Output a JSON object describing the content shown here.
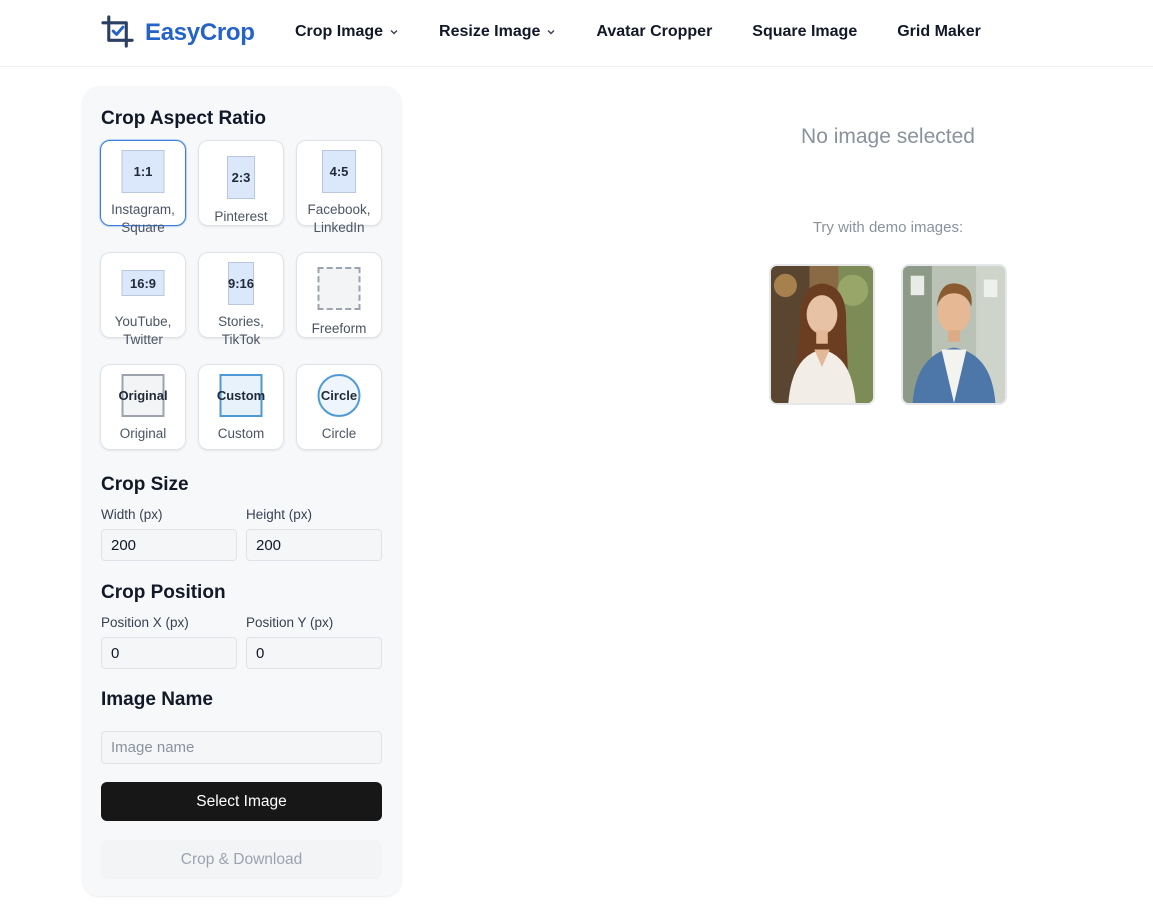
{
  "header": {
    "brand": "EasyCrop",
    "nav": [
      {
        "label": "Crop Image",
        "dropdown": true
      },
      {
        "label": "Resize Image",
        "dropdown": true
      },
      {
        "label": "Avatar Cropper",
        "dropdown": false
      },
      {
        "label": "Square Image",
        "dropdown": false
      },
      {
        "label": "Grid Maker",
        "dropdown": false
      }
    ]
  },
  "sidebar": {
    "aspect_title": "Crop Aspect Ratio",
    "ratios": [
      {
        "tag": "1:1",
        "label": "Instagram, Square",
        "selected": true
      },
      {
        "tag": "2:3",
        "label": "Pinterest"
      },
      {
        "tag": "4:5",
        "label": "Facebook, LinkedIn"
      },
      {
        "tag": "16:9",
        "label": "YouTube, Twitter"
      },
      {
        "tag": "9:16",
        "label": "Stories, TikTok"
      },
      {
        "tag": "",
        "label": "Freeform"
      },
      {
        "tag": "Original",
        "label": "Original"
      },
      {
        "tag": "Custom",
        "label": "Custom"
      },
      {
        "tag": "Circle",
        "label": "Circle"
      }
    ],
    "size_title": "Crop Size",
    "width_label": "Width (px)",
    "width_value": "200",
    "height_label": "Height (px)",
    "height_value": "200",
    "position_title": "Crop Position",
    "pos_x_label": "Position X (px)",
    "pos_x_value": "0",
    "pos_y_label": "Position Y (px)",
    "pos_y_value": "0",
    "name_title": "Image Name",
    "name_placeholder": "Image name",
    "select_button": "Select Image",
    "crop_button": "Crop & Download"
  },
  "main": {
    "empty_text": "No image selected",
    "demo_label": "Try with demo images:"
  },
  "colors": {
    "brand": "#2563c9",
    "selected_border": "#3b7de0",
    "primary_button": "#171717"
  }
}
